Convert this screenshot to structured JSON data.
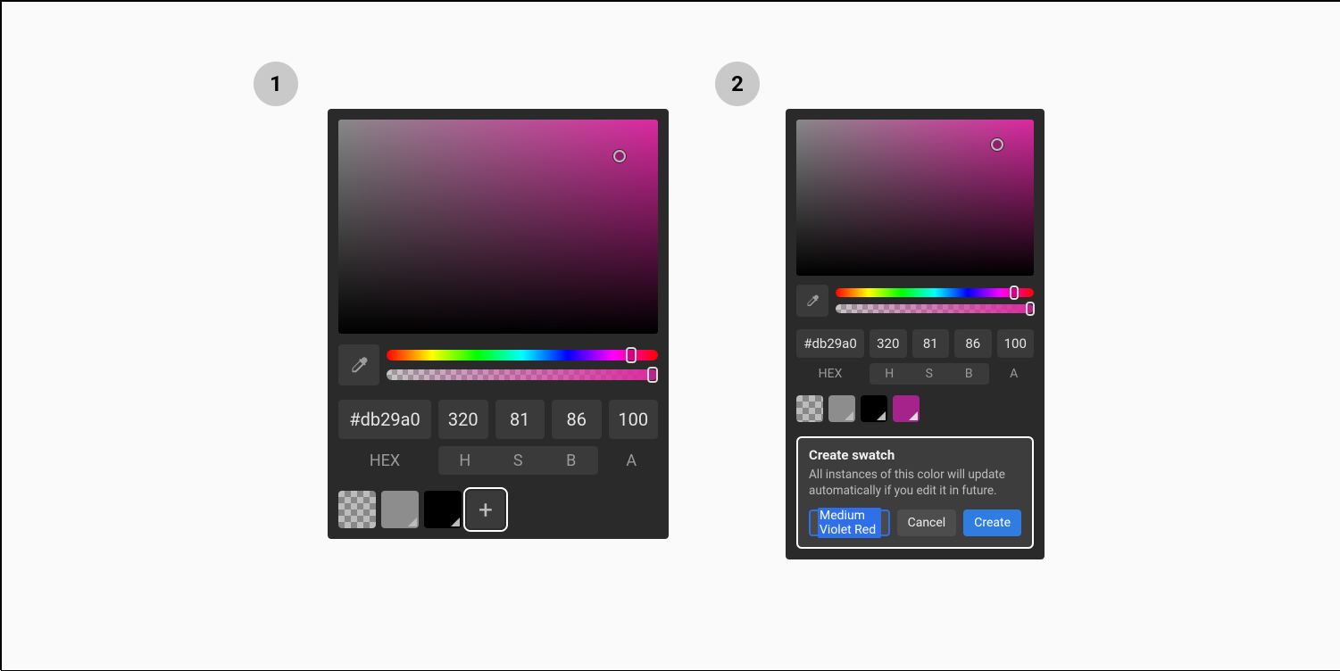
{
  "steps": {
    "one": "1",
    "two": "2"
  },
  "color": {
    "hex": "#db29a0",
    "h": "320",
    "s": "81",
    "b": "86",
    "a": "100"
  },
  "labels": {
    "hex": "HEX",
    "h": "H",
    "s": "S",
    "b": "B",
    "a": "A"
  },
  "swatch_icons": {
    "transparent": "transparent-swatch",
    "grey": "grey-swatch",
    "black": "black-swatch",
    "add": "+"
  },
  "popover": {
    "title": "Create swatch",
    "body": "All instances of this color will update automatically if you edit it in future.",
    "name": "Medium Violet Red",
    "cancel": "Cancel",
    "create": "Create"
  }
}
